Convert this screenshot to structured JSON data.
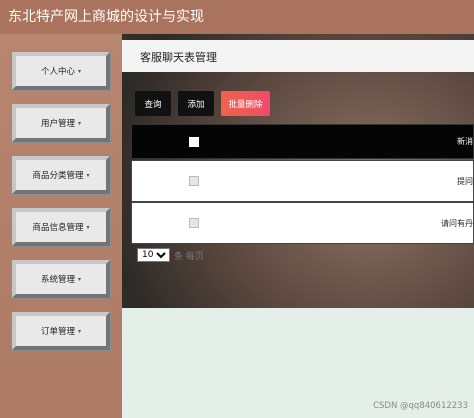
{
  "app": {
    "title": "东北特产网上商城的设计与实现"
  },
  "sidebar": {
    "items": [
      {
        "label": "个人中心"
      },
      {
        "label": "用户管理"
      },
      {
        "label": "商品分类管理"
      },
      {
        "label": "商品信息管理"
      },
      {
        "label": "系统管理"
      },
      {
        "label": "订单管理"
      }
    ],
    "caret": "▾"
  },
  "page": {
    "title": "客服聊天表管理"
  },
  "toolbar": {
    "query_label": "查询",
    "add_label": "添加",
    "batch_delete_label": "批量删除"
  },
  "table": {
    "header_partial": "新消",
    "rows": [
      {
        "text": "提问"
      },
      {
        "text": "请问有丹"
      }
    ]
  },
  "pagination": {
    "page_size": "10",
    "suffix": "条 每页"
  },
  "watermark": "CSDN @qq840612233"
}
